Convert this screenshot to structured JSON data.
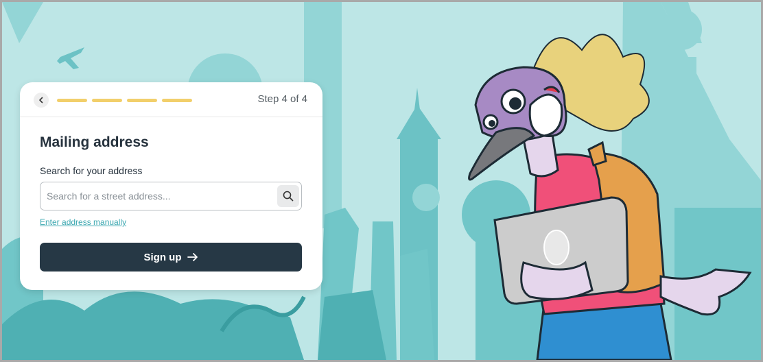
{
  "header": {
    "step_label": "Step 4 of 4",
    "progress_steps_completed": 4,
    "progress_steps_total": 4
  },
  "form": {
    "title": "Mailing address",
    "search_label": "Search for your address",
    "search_placeholder": "Search for a street address...",
    "search_value": "",
    "manual_link": "Enter address manually",
    "submit_label": "Sign up"
  },
  "colors": {
    "progress_active": "#f2cf6b",
    "button_bg": "#263845",
    "link": "#3aa7b0",
    "background": "#bde6e6",
    "skyline": "#71c6c8"
  },
  "icons": {
    "back": "chevron-left-icon",
    "search": "search-icon",
    "submit": "arrow-right-icon"
  }
}
